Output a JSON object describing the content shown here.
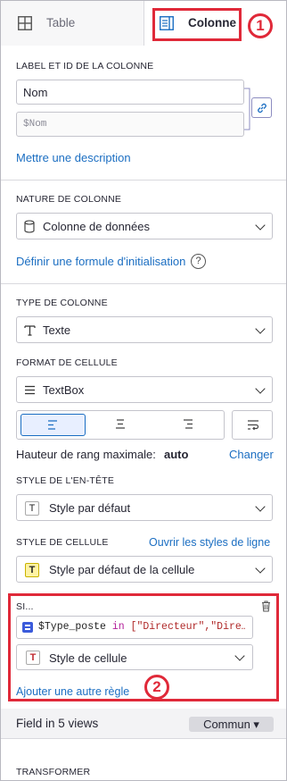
{
  "tabs": {
    "table": "Table",
    "column": "Colonne"
  },
  "label_section": {
    "heading": "LABEL ET ID DE LA COLONNE",
    "label_value": "Nom",
    "id_value": "$Nom",
    "description_link": "Mettre une description"
  },
  "nature_section": {
    "heading": "NATURE DE COLONNE",
    "value": "Colonne de données",
    "formula_link": "Définir une formule d'initialisation",
    "help_icon": "?"
  },
  "type_section": {
    "heading": "TYPE DE COLONNE",
    "value": "Texte",
    "format_heading": "FORMAT DE CELLULE",
    "format_value": "TextBox",
    "max_row_height_label": "Hauteur de rang maximale:",
    "max_row_height_value": "auto",
    "change_link": "Changer"
  },
  "header_style": {
    "heading": "STYLE DE L'EN-TÊTE",
    "value": "Style par défaut",
    "icon_letter": "T"
  },
  "cell_style": {
    "heading": "STYLE DE CELLULE",
    "row_styles_link": "Ouvrir les styles de ligne",
    "value": "Style par défaut de la cellule",
    "icon_letter": "T"
  },
  "rule": {
    "heading": "SI...",
    "formula": {
      "var": "$Type_poste",
      "keyword": "in",
      "rest": "[\"Directeur\",\"Dire…"
    },
    "style_value": "Style de cellule",
    "style_icon_letter": "T",
    "add_rule_link": "Ajouter une autre règle"
  },
  "field_views": {
    "text": "Field in 5 views",
    "badge": "Commun ▾"
  },
  "transform": {
    "heading": "TRANSFORMER"
  },
  "annotations": {
    "one": "1",
    "two": "2"
  },
  "colors": {
    "accent": "#1b6ec2",
    "annotation_red": "#e02939",
    "header_icon_yellow": "#fff3a3"
  }
}
